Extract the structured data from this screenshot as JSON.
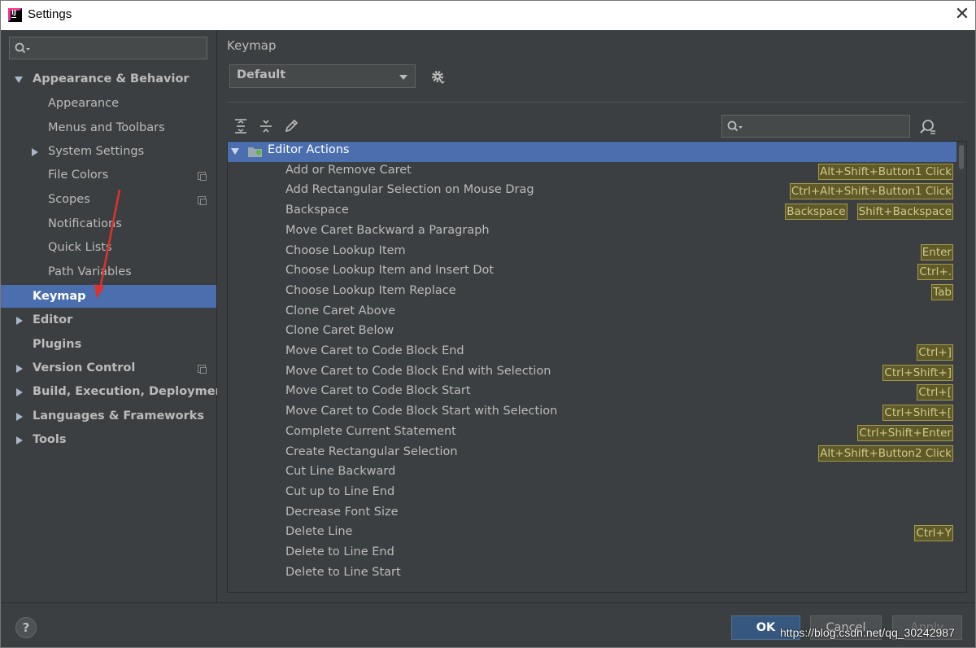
{
  "window": {
    "title": "Settings",
    "close_glyph": "✕"
  },
  "sidebar": {
    "search_placeholder": "",
    "items": [
      {
        "label": "Appearance & Behavior",
        "expanded": true
      },
      {
        "label": "Appearance"
      },
      {
        "label": "Menus and Toolbars"
      },
      {
        "label": "System Settings"
      },
      {
        "label": "File Colors"
      },
      {
        "label": "Scopes"
      },
      {
        "label": "Notifications"
      },
      {
        "label": "Quick Lists"
      },
      {
        "label": "Path Variables"
      },
      {
        "label": "Keymap",
        "selected": true
      },
      {
        "label": "Editor"
      },
      {
        "label": "Plugins"
      },
      {
        "label": "Version Control"
      },
      {
        "label": "Build, Execution, Deployment"
      },
      {
        "label": "Languages & Frameworks"
      },
      {
        "label": "Tools"
      }
    ]
  },
  "main": {
    "heading": "Keymap",
    "keymap_select": "Default",
    "group": "Editor Actions",
    "actions": [
      {
        "name": "Add or Remove Caret",
        "keys": [
          "Alt+Shift+Button1 Click"
        ]
      },
      {
        "name": "Add Rectangular Selection on Mouse Drag",
        "keys": [
          "Ctrl+Alt+Shift+Button1 Click"
        ]
      },
      {
        "name": "Backspace",
        "keys": [
          "Backspace",
          "Shift+Backspace"
        ]
      },
      {
        "name": "Move Caret Backward a Paragraph",
        "keys": []
      },
      {
        "name": "Choose Lookup Item",
        "keys": [
          "Enter"
        ]
      },
      {
        "name": "Choose Lookup Item and Insert Dot",
        "keys": [
          "Ctrl+."
        ]
      },
      {
        "name": "Choose Lookup Item Replace",
        "keys": [
          "Tab"
        ]
      },
      {
        "name": "Clone Caret Above",
        "keys": []
      },
      {
        "name": "Clone Caret Below",
        "keys": []
      },
      {
        "name": "Move Caret to Code Block End",
        "keys": [
          "Ctrl+]"
        ]
      },
      {
        "name": "Move Caret to Code Block End with Selection",
        "keys": [
          "Ctrl+Shift+]"
        ]
      },
      {
        "name": "Move Caret to Code Block Start",
        "keys": [
          "Ctrl+["
        ]
      },
      {
        "name": "Move Caret to Code Block Start with Selection",
        "keys": [
          "Ctrl+Shift+["
        ]
      },
      {
        "name": "Complete Current Statement",
        "keys": [
          "Ctrl+Shift+Enter"
        ]
      },
      {
        "name": "Create Rectangular Selection",
        "keys": [
          "Alt+Shift+Button2 Click"
        ]
      },
      {
        "name": "Cut Line Backward",
        "keys": []
      },
      {
        "name": "Cut up to Line End",
        "keys": []
      },
      {
        "name": "Decrease Font Size",
        "keys": []
      },
      {
        "name": "Delete Line",
        "keys": [
          "Ctrl+Y"
        ]
      },
      {
        "name": "Delete to Line End",
        "keys": []
      },
      {
        "name": "Delete to Line Start",
        "keys": []
      }
    ]
  },
  "footer": {
    "help_label": "?",
    "ok_label": "OK",
    "cancel_label": "Cancel",
    "apply_label": "Apply",
    "watermark": "https://blog.csdn.net/qq_30242987"
  },
  "colors": {
    "background": "#3c3f41",
    "selection": "#4b6eaf",
    "shortcut_bg": "#5f5a28",
    "shortcut_border": "#a2994a",
    "annotation_arrow": "#e0312b"
  }
}
